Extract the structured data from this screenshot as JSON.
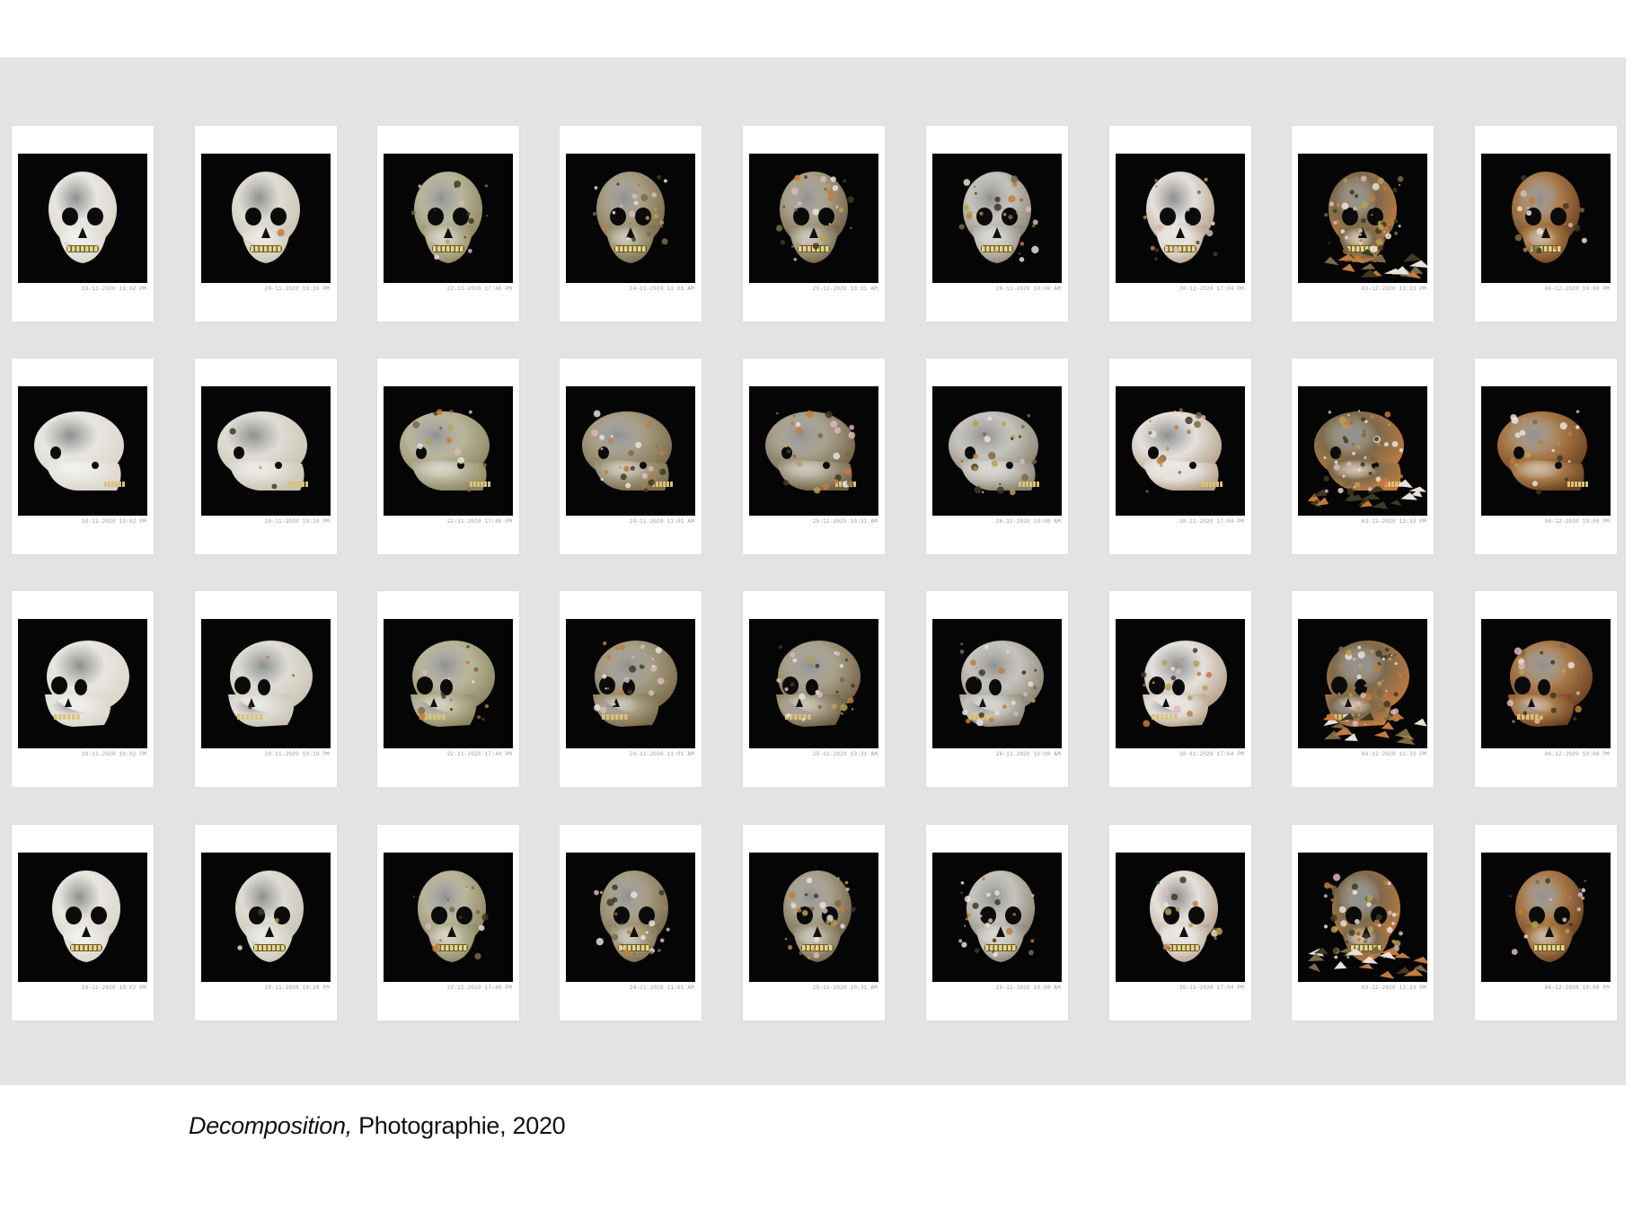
{
  "caption": {
    "title": "Decomposition,",
    "rest": " Photographie, 2020"
  },
  "colors": {
    "background": "#ffffff",
    "panel": "#e3e3e3",
    "card": "#ffffff",
    "photo_background": "#050505"
  },
  "grid": {
    "rows": [
      {
        "view": "front"
      },
      {
        "view": "side"
      },
      {
        "view": "three-quarter"
      },
      {
        "view": "front-tilted"
      }
    ],
    "columns": [
      {
        "stage": 1,
        "tone": "#e8e6e0",
        "accent": "#d8d4c8",
        "mold": 0.0,
        "timestamp": "19-11-2020 19:02 PM"
      },
      {
        "stage": 2,
        "tone": "#dedcd4",
        "accent": "#c9c3b2",
        "mold": 0.05,
        "timestamp": "20-11-2020 19:10 PM"
      },
      {
        "stage": 3,
        "tone": "#b8b49a",
        "accent": "#8d8560",
        "mold": 0.25,
        "timestamp": "22-11-2020 17:40 PM"
      },
      {
        "stage": 4,
        "tone": "#a39a80",
        "accent": "#7a6a48",
        "mold": 0.45,
        "timestamp": "24-11-2020 11:01 AM"
      },
      {
        "stage": 5,
        "tone": "#a69e88",
        "accent": "#6f5e42",
        "mold": 0.5,
        "timestamp": "25-11-2020 10:31 AM"
      },
      {
        "stage": 6,
        "tone": "#c4c2bc",
        "accent": "#8a8270",
        "mold": 0.45,
        "timestamp": "26-11-2020 10:00 AM"
      },
      {
        "stage": 7,
        "tone": "#e4e0dc",
        "accent": "#b59e86",
        "mold": 0.3,
        "timestamp": "30-11-2020 17:04 PM"
      },
      {
        "stage": 8,
        "tone": "#7d6a4c",
        "accent": "#c27b3d",
        "mold": 0.9,
        "timestamp": "03-12-2020 13:33 PM"
      },
      {
        "stage": 9,
        "tone": "#a87a4a",
        "accent": "#6b3f1f",
        "mold": 0.35,
        "timestamp": "06-12-2020 19:00 PM"
      }
    ]
  }
}
